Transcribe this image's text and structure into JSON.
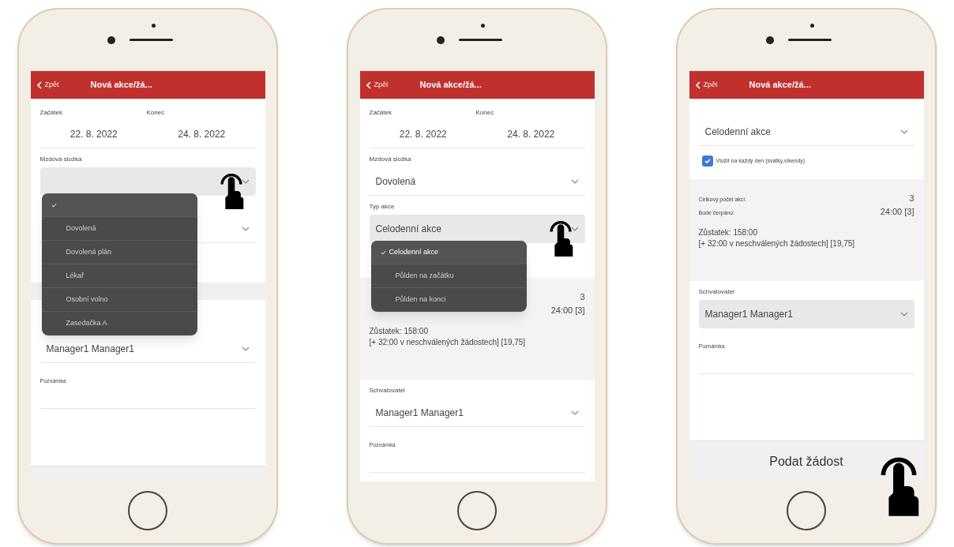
{
  "phones": [
    {
      "header": {
        "back": "Zpět",
        "title": "Nová akce/žá..."
      },
      "blocks": [
        {
          "kind": "date_range",
          "start_label": "Začátek",
          "end_label": "Konec",
          "start": "22. 8. 2022",
          "end": "24. 8. 2022"
        },
        {
          "kind": "select",
          "label": "Mzdová složka",
          "highlighted": true,
          "tap": true,
          "dropdown": [
            {
              "selected": true
            },
            {
              "label": "Dovolená",
              "selected": false
            },
            {
              "label": "Dovolená plán",
              "selected": false
            },
            {
              "label": "Lékař",
              "selected": false
            },
            {
              "label": "Osobní volno",
              "selected": false
            },
            {
              "label": "Zasedačka A",
              "selected": false
            }
          ]
        },
        {
          "kind": "select",
          "highlighted": false
        },
        {
          "kind": "band"
        },
        {
          "kind": "select",
          "value": "Manager1 Manager1",
          "highlighted": false
        },
        {
          "kind": "note",
          "label": "Poznámka"
        },
        {
          "kind": "footer_button"
        }
      ]
    },
    {
      "header": {
        "back": "Zpět",
        "title": "Nová akce/žá..."
      },
      "blocks": [
        {
          "kind": "date_range",
          "start_label": "Začátek",
          "end_label": "Konec",
          "start": "22. 8. 2022",
          "end": "24. 8. 2022"
        },
        {
          "kind": "select",
          "label": "Mzdová složka",
          "value": "Dovolená",
          "highlighted": false
        },
        {
          "kind": "select",
          "label": "Typ akce",
          "value": "Celodenní akce",
          "highlighted": true,
          "tap": true,
          "dropdown": [
            {
              "label": "Celodenní akce",
              "selected": true
            },
            {
              "label": "Půlden na začátku",
              "selected": false
            },
            {
              "label": "Půlden na konci",
              "selected": false
            }
          ]
        },
        {
          "kind": "blank"
        },
        {
          "kind": "summary",
          "rows": [
            {
              "value": "3"
            },
            {
              "value": "24:00 [3]"
            }
          ],
          "balance": [
            "Zůstatek: 158:00",
            "[+ 32:00 v neschválených žádostech] [19,75]"
          ]
        },
        {
          "kind": "select",
          "label": "Schvalovatel",
          "value": "Manager1 Manager1",
          "highlighted": false
        },
        {
          "kind": "note",
          "label": "Poznámka"
        }
      ]
    },
    {
      "header": {
        "back": "Zpět",
        "title": "Nová akce/žá..."
      },
      "blocks": [
        {
          "kind": "select",
          "value": "Celodenní akce",
          "highlighted": false
        },
        {
          "kind": "checkbox",
          "label": "Vložit na každý den (svátky,víkendy)",
          "checked": true
        },
        {
          "kind": "summary",
          "rows": [
            {
              "label": "Celkový počet akcí:",
              "value": "3"
            },
            {
              "label": "Bude čerpáno:",
              "value": "24:00 [3]"
            }
          ],
          "balance": [
            "Zůstatek: 158:00",
            "[+ 32:00 v neschválených žádostech] [19,75]"
          ]
        },
        {
          "kind": "select",
          "label": "Schvalovatel",
          "value": "Manager1 Manager1",
          "highlighted": true
        },
        {
          "kind": "note",
          "label": "Poznámka"
        },
        {
          "kind": "footer_button",
          "label": "Podat žádost",
          "tap": true
        }
      ]
    }
  ]
}
